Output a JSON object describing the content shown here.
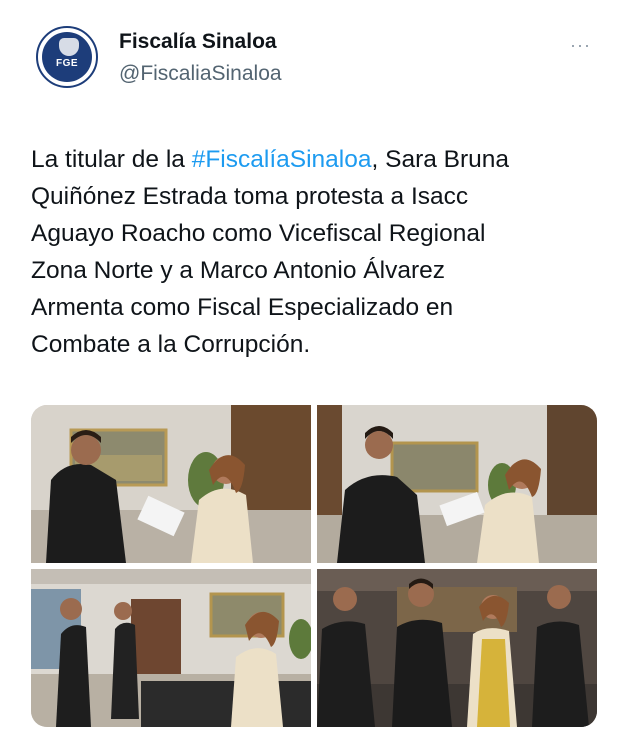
{
  "account": {
    "name": "Fiscalía Sinaloa",
    "handle": "@FiscaliaSinaloa",
    "avatar_text": "FGE",
    "more_icon": "more-dots-icon"
  },
  "tweet": {
    "line1_prefix": "La titular de la ",
    "hashtag": "#FiscalíaSinaloa",
    "line1_suffix": ", Sara Bruna",
    "line2": "Quiñónez Estrada toma protesta a Isacc",
    "line3": "Aguayo Roacho como Vicefiscal Regional",
    "line4": "Zona Norte y a Marco Antonio Álvarez",
    "line5": "Armenta como Fiscal Especializado en",
    "line6": "Combate a la Corrupción."
  },
  "colors": {
    "hashtag": "#1d9bf0",
    "handle": "#536471",
    "text": "#0f1419"
  }
}
